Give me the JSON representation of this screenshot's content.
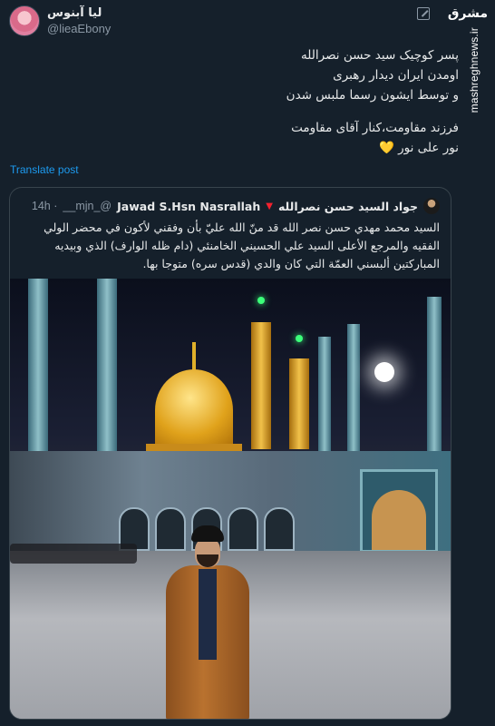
{
  "watermark": {
    "logo_text": "مشرق",
    "site": "mashreghnews.ir"
  },
  "author": {
    "display_name": "لیا آبنوس",
    "handle": "@lieaEbony"
  },
  "tweet": {
    "line1": "پسر کوچیک سید حسن نصرالله",
    "line2": "اومدن ایران دیدار رهبری",
    "line3": "و توسط ایشون رسما ملبس شدن",
    "line4": "فرزند مقاومت،کنار آقای مقاومت",
    "line5": "نور علی نور",
    "heart": "💛"
  },
  "translate_label": "Translate post",
  "quoted": {
    "name_ar": "جواد السيد حسن نصرالله",
    "name_en": "Jawad S.Hsn Nasrallah",
    "handle": "@_mjn__",
    "time": "· 14h",
    "text": "السيد محمد مهدي حسن نصر الله قد منّ الله عليّ بأن وفقني لأكون في محضر الولي الفقيه والمرجع الأعلى السيد علي الحسيني الخامنئي (دام ظله الوارف) الذي وبيديه المباركتين ألبسني العمّة التي كان والدي (قدس سره) متوجا بها."
  },
  "colors": {
    "background": "#15202b",
    "text": "#e7e9ea",
    "muted": "#8b98a5",
    "link": "#1d9bf0",
    "border": "#38444d"
  },
  "icons": [
    "edit-icon",
    "verified-badge-icon",
    "avatar"
  ]
}
